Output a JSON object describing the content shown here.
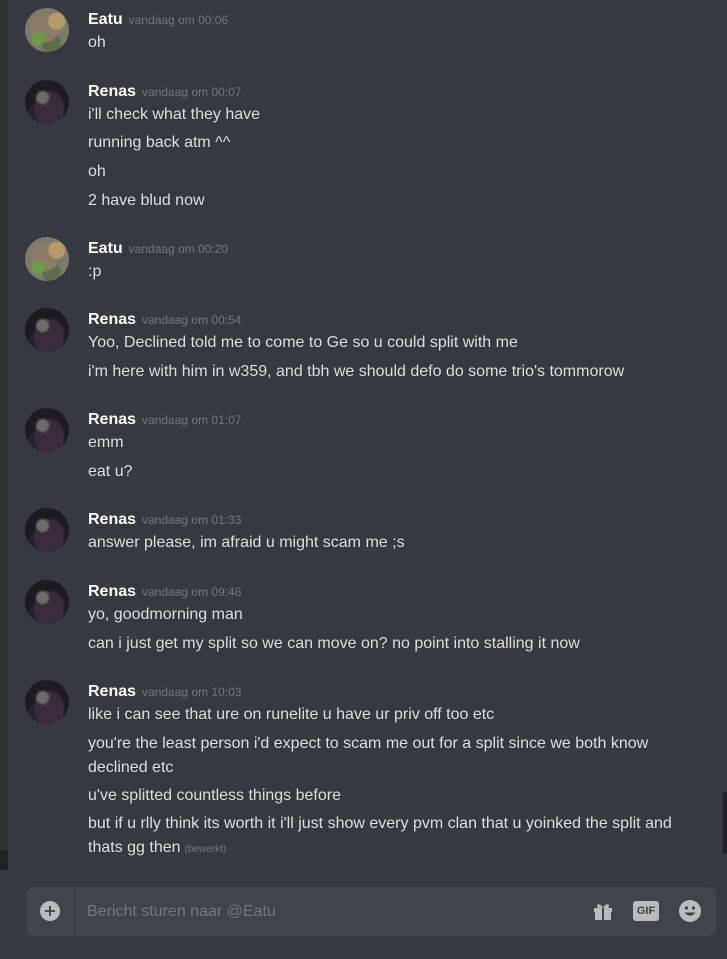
{
  "messages": [
    {
      "user": "Eatu",
      "time": "vandaag om 00:06",
      "avatar": "eatu",
      "lines": [
        "oh"
      ]
    },
    {
      "user": "Renas",
      "time": "vandaag om 00:07",
      "avatar": "renas",
      "lines": [
        "i'll check what they have",
        "running back atm ^^",
        "oh",
        "2 have blud now"
      ]
    },
    {
      "user": "Eatu",
      "time": "vandaag om 00:20",
      "avatar": "eatu",
      "lines": [
        ":p"
      ]
    },
    {
      "user": "Renas",
      "time": "vandaag om 00:54",
      "avatar": "renas",
      "lines": [
        "Yoo, Declined told me to come to Ge so u could split with me",
        "i'm here with him in w359, and tbh we should defo do some trio's tommorow"
      ]
    },
    {
      "user": "Renas",
      "time": "vandaag om 01:07",
      "avatar": "renas",
      "lines": [
        "emm",
        "eat u?"
      ]
    },
    {
      "user": "Renas",
      "time": "vandaag om 01:33",
      "avatar": "renas",
      "lines": [
        "answer please, im afraid u might scam me ;s"
      ]
    },
    {
      "user": "Renas",
      "time": "vandaag om 09:48",
      "avatar": "renas",
      "lines": [
        "yo, goodmorning man",
        "can i just get my split so we can move on? no point into stalling it now"
      ]
    },
    {
      "user": "Renas",
      "time": "vandaag om 10:03",
      "avatar": "renas",
      "lines": [
        "like i can see that ure on runelite u have ur priv off too etc",
        "you're the least person i'd expect to scam me out for a split since we both know declined etc",
        "u've splitted countless things before",
        "but if u rlly think its worth it i'll just show every pvm clan that u yoinked the split and thats gg then"
      ],
      "edited_label": "(bewerkt)"
    }
  ],
  "composer": {
    "placeholder": "Bericht sturen naar @Eatu",
    "add_icon": "plus-circle-icon",
    "gift_icon": "gift-icon",
    "gif_label": "GIF",
    "emoji_icon": "smiley-icon"
  },
  "colors": {
    "background": "#36393f",
    "input_background": "#40444b",
    "username": "#ffffff",
    "timestamp": "#72767d",
    "text": "#dcddde"
  }
}
